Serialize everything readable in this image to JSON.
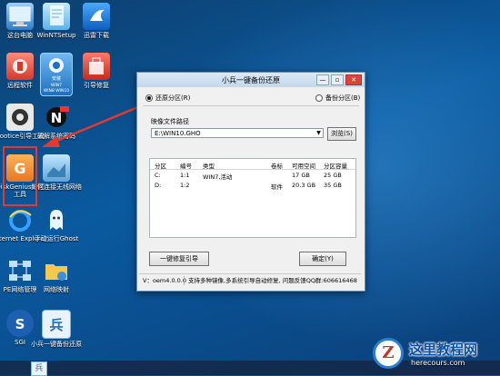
{
  "desktop": {
    "icons": [
      {
        "label": "这台电脑",
        "icon": "computer-icon"
      },
      {
        "label": "WinNTSetup",
        "icon": "winntsetup-icon"
      },
      {
        "label": "迅雷下载",
        "icon": "thunder-icon"
      },
      {
        "label": "远程软件",
        "icon": "remote-software-icon"
      },
      {
        "label": "小兵一键装机",
        "icon": "xiaobing-install-icon",
        "badge": "安装WIN7 WIN8 WIN10"
      },
      {
        "label": "引导修复",
        "icon": "boot-repair-icon"
      },
      {
        "label": "Bootice引导工具",
        "icon": "bootice-icon"
      },
      {
        "label": "破解系统密码",
        "icon": "password-crack-icon"
      },
      {
        "label": "DiskGenius分区工具",
        "icon": "diskgenius-icon"
      },
      {
        "label": "如何连接无线网络",
        "icon": "wireless-help-icon"
      },
      {
        "label": "Internet Explorer",
        "icon": "ie-icon"
      },
      {
        "label": "手动运行Ghost",
        "icon": "ghost-icon"
      },
      {
        "label": "PE网络管理",
        "icon": "network-manager-icon"
      },
      {
        "label": "网络映射",
        "icon": "network-map-icon"
      },
      {
        "label": "SGI",
        "icon": "sgi-icon"
      },
      {
        "label": "小兵一键备份还原",
        "icon": "xiaobing-backup-icon"
      }
    ]
  },
  "window": {
    "title": "小兵一键备份还原",
    "controls": {
      "minimize": "—",
      "restore": "▫",
      "close": "✕"
    },
    "restore_option": "还原分区(R)",
    "backup_option": "备份分区(B)",
    "image_path_label": "映像文件路径",
    "image_path_value": "E:\\WIN10.GHO",
    "browse_button": "浏览(S)",
    "table": {
      "headers": [
        "分区",
        "编号",
        "类型",
        "卷标",
        "可用空间",
        "分区容量"
      ],
      "rows": [
        [
          "C:",
          "1:1",
          "WIN7,活动",
          "",
          "17 GB",
          "25 GB"
        ],
        [
          "D:",
          "1:2",
          "",
          "软件",
          "20.3 GB",
          "35 GB"
        ]
      ]
    },
    "repair_boot_button": "一键修复引导",
    "confirm_button": "确定(Y)",
    "status": {
      "version": "V：oem4.0.0.0",
      "message": "支持多种镜像,多系统引导自动修复, 问题反馈QQ群:606616468"
    }
  },
  "watermark": {
    "title": "这里教程网",
    "url": "herecours.com"
  },
  "colors": {
    "highlight_frame": "#e23a2e",
    "arrow": "#e23a2e",
    "desktop_bg": "#0a5aa0"
  }
}
